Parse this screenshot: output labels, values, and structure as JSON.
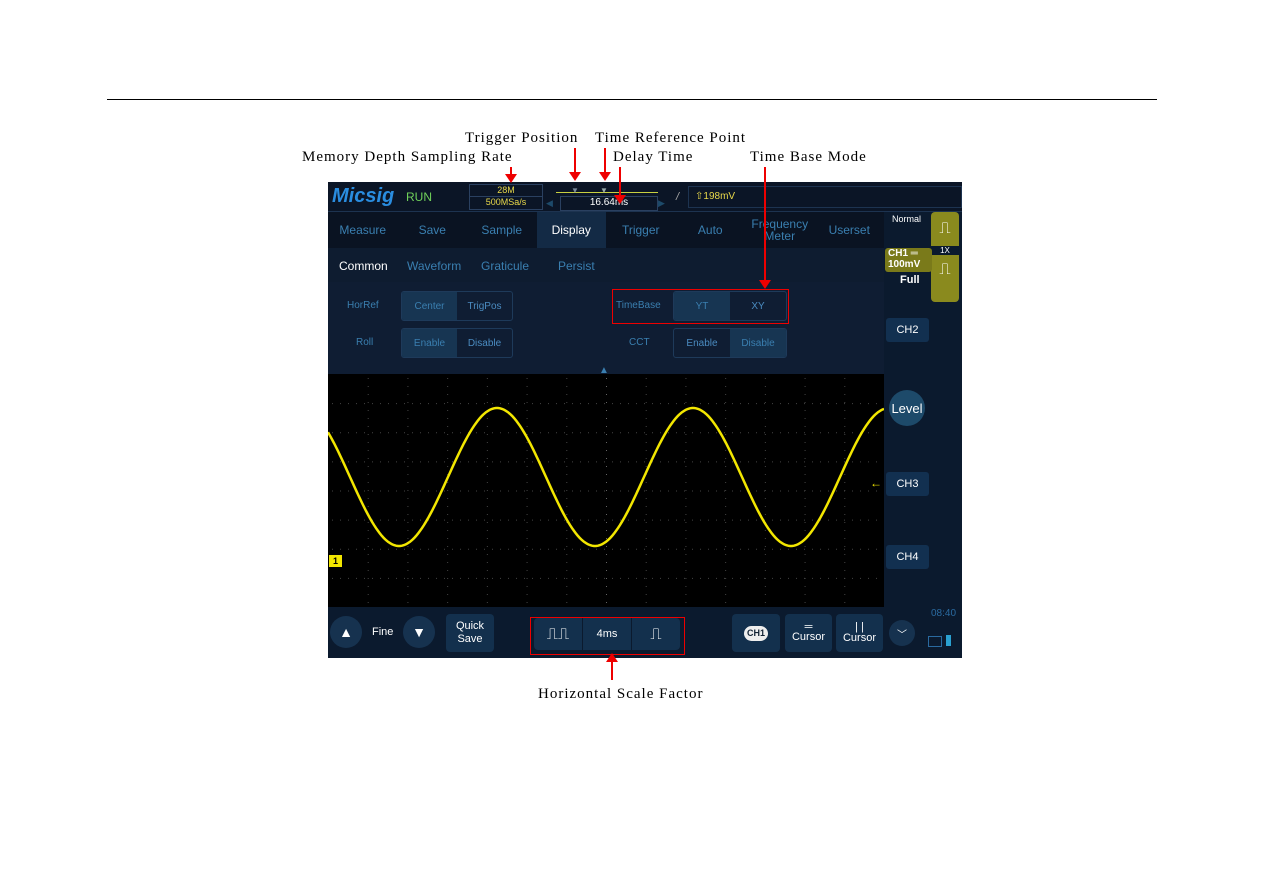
{
  "annotations": {
    "trigger_position": "Trigger Position",
    "time_reference_point": "Time Reference Point",
    "memory_depth_sampling_rate": "Memory Depth Sampling Rate",
    "delay_time": "Delay Time",
    "time_base_mode": "Time Base Mode",
    "horizontal_scale_factor": "Horizontal Scale Factor"
  },
  "status": {
    "logo": "Micsig",
    "run_state": "RUN",
    "memory_depth": "28M",
    "sample_rate": "500MSa/s",
    "delay_time": "16.64ms",
    "trigger_slope": "/",
    "trigger_level": "⇧198mV"
  },
  "menu": {
    "items": [
      {
        "label": "Measure"
      },
      {
        "label": "Save"
      },
      {
        "label": "Sample"
      },
      {
        "label": "Display",
        "active": true
      },
      {
        "label": "Trigger"
      },
      {
        "label": "Auto"
      },
      {
        "label": "Frequency Meter"
      },
      {
        "label": "Userset"
      }
    ]
  },
  "submenu": {
    "items": [
      "Common",
      "Waveform",
      "Graticule",
      "Persist"
    ],
    "active": "Common"
  },
  "settings": {
    "horref_label": "HorRef",
    "horref_options": [
      "Center",
      "TrigPos"
    ],
    "horref_selected": "Center",
    "roll_label": "Roll",
    "roll_options": [
      "Enable",
      "Disable"
    ],
    "roll_selected": "Enable",
    "timebase_label": "TimeBase",
    "timebase_options": [
      "YT",
      "XY"
    ],
    "timebase_selected": "YT",
    "cct_label": "CCT",
    "cct_options": [
      "Enable",
      "Disable"
    ],
    "cct_selected": "Disable"
  },
  "side": {
    "trigger_mode": "Normal",
    "ch1_label": "CH1 ═",
    "ch1_scale": "100mV",
    "bandwidth": "Full",
    "probe": "1X",
    "ch2": "CH2",
    "level": "Level",
    "ch3": "CH3",
    "ch4": "CH4"
  },
  "channel_marker": "1",
  "bottom": {
    "fine": "Fine",
    "quick_save": "Quick Save",
    "timebase": "4ms",
    "ch1_chip": "CH1",
    "cursor_h": "Cursor",
    "cursor_v": "Cursor",
    "time": "08:40"
  },
  "colors": {
    "waveform": "#f2e600",
    "accent": "#2a8de0",
    "annotation": "#e00000"
  }
}
